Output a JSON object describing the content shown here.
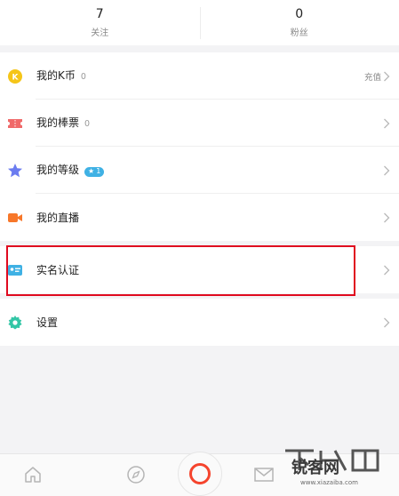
{
  "stats": [
    {
      "value": "7",
      "label": "关注"
    },
    {
      "value": "0",
      "label": "粉丝"
    }
  ],
  "menu": {
    "kcoin": {
      "label": "我的K币",
      "count": "0",
      "action": "充值"
    },
    "tickets": {
      "label": "我的棒票",
      "count": "0"
    },
    "level": {
      "label": "我的等级",
      "badge": "1"
    },
    "live": {
      "label": "我的直播"
    },
    "verify": {
      "label": "实名认证"
    },
    "settings": {
      "label": "设置"
    }
  },
  "colors": {
    "highlight": "#e00a1f",
    "kcoin": "#f5c518",
    "tickets": "#f06a6a",
    "level": "#6b7cf0",
    "live": "#f7772a",
    "verify": "#3fb1e4",
    "settings": "#33c6a6",
    "record": "#f5442d"
  },
  "tabbar": {
    "icons": [
      "home-icon",
      "compass-icon",
      "record-icon",
      "mail-icon"
    ]
  },
  "watermark": {
    "text": "锐客网",
    "url": "www.xiazaiba.com"
  }
}
